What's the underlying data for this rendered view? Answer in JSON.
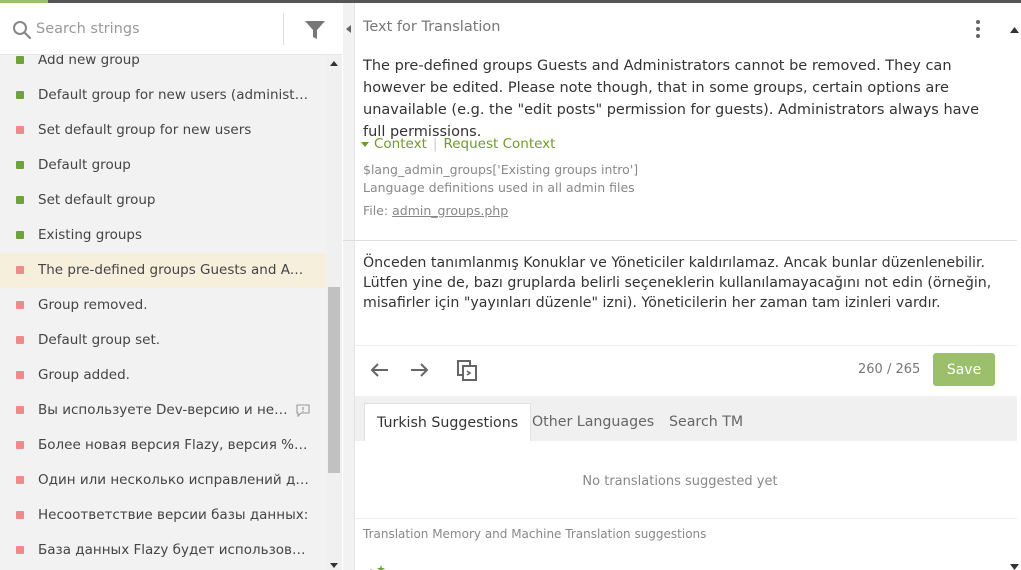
{
  "search": {
    "placeholder": "Search strings"
  },
  "strings": [
    {
      "label": "Add new group",
      "status": "green"
    },
    {
      "label": "Default group for new users (administrator can",
      "status": "green"
    },
    {
      "label": "Set default group for new users",
      "status": "red"
    },
    {
      "label": "Default group",
      "status": "green"
    },
    {
      "label": "Set default group",
      "status": "green"
    },
    {
      "label": "Existing groups",
      "status": "green"
    },
    {
      "label": "The pre-defined groups Guests and Administrators cannot be removed",
      "status": "red",
      "selected": true
    },
    {
      "label": "Group removed.",
      "status": "red"
    },
    {
      "label": "Default group set.",
      "status": "red"
    },
    {
      "label": "Group added.",
      "status": "red"
    },
    {
      "label": "Вы используете Dev-версию и не будете уведомлены",
      "status": "red",
      "has_comment": true
    },
    {
      "label": "Более новая версия Flazy, версия %s, доступна",
      "status": "red"
    },
    {
      "label": "Один или несколько исправлений доступны",
      "status": "red"
    },
    {
      "label": "Несоответствие версии базы данных:",
      "status": "red"
    },
    {
      "label": "База данных Flazy будет использована в качестве",
      "status": "red"
    }
  ],
  "source": {
    "header": "Text for Translation",
    "text": "The pre-defined groups Guests and Administrators cannot be removed. They can however be edited. Please note though, that in some groups, certain options are unavailable (e.g. the \"edit posts\" permission for guests). Administrators always have full permissions.",
    "context_label": "Context",
    "request_context_label": "Request Context",
    "key": "$lang_admin_groups['Existing groups intro']",
    "description": "Language definitions used in all admin files",
    "file_label": "File:",
    "file_name": "admin_groups.php"
  },
  "translation": {
    "text": "Önceden tanımlanmış Konuklar ve Yöneticiler kaldırılamaz. Ancak bunlar düzenlenebilir. Lütfen yine de, bazı gruplarda belirli seçeneklerin kullanılamayacağını not edin (örneğin, misafirler için \"yayınları düzenle\" izni). Yöneticilerin her zaman tam izinleri vardır."
  },
  "editor": {
    "counter": "260 / 265",
    "save_label": "Save"
  },
  "tabs": [
    {
      "label": "Turkish Suggestions",
      "active": true
    },
    {
      "label": "Other Languages"
    },
    {
      "label": "Search TM"
    }
  ],
  "suggestions": {
    "empty_text": "No translations suggested yet",
    "tm_label": "Translation Memory and Machine Translation suggestions"
  },
  "colors": {
    "accent": "#9bbf6a",
    "status_green": "#6ea33b",
    "status_red": "#f08a8a",
    "selected_row": "#f5efdc"
  }
}
